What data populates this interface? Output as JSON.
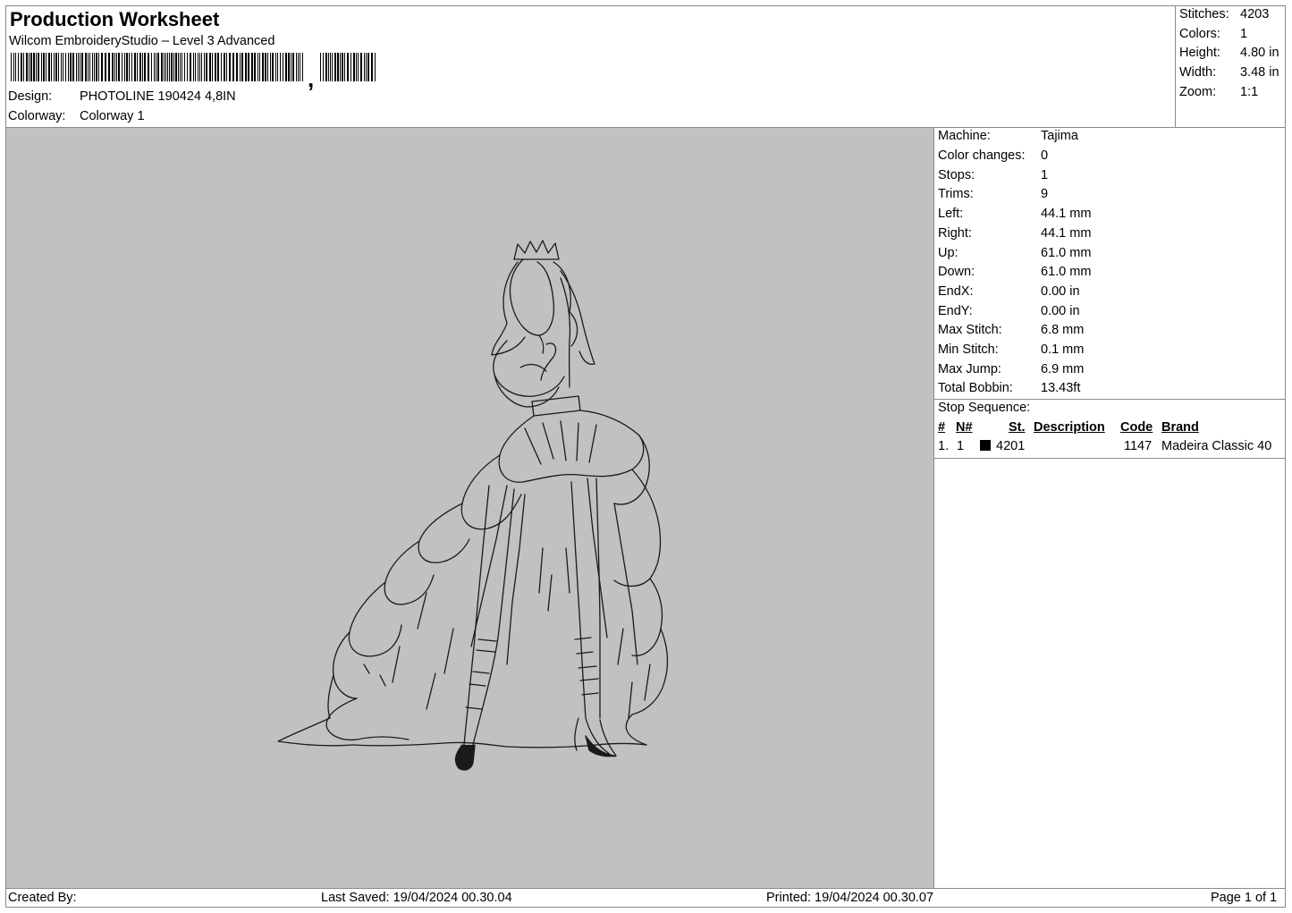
{
  "header": {
    "title": "Production Worksheet",
    "subtitle": "Wilcom EmbroideryStudio – Level 3 Advanced",
    "design_label": "Design:",
    "design_value": "PHOTOLINE 190424 4,8IN",
    "colorway_label": "Colorway:",
    "colorway_value": "Colorway 1"
  },
  "stats": [
    {
      "label": "Stitches:",
      "value": "4203"
    },
    {
      "label": "Colors:",
      "value": "1"
    },
    {
      "label": "Height:",
      "value": "4.80 in"
    },
    {
      "label": "Width:",
      "value": "3.48 in"
    },
    {
      "label": "Zoom:",
      "value": "1:1"
    }
  ],
  "machine_info": [
    {
      "label": "Machine:",
      "value": "Tajima"
    },
    {
      "label": "Color changes:",
      "value": "0"
    },
    {
      "label": "Stops:",
      "value": "1"
    },
    {
      "label": "Trims:",
      "value": "9"
    },
    {
      "label": "Left:",
      "value": "44.1 mm"
    },
    {
      "label": "Right:",
      "value": "44.1 mm"
    },
    {
      "label": "Up:",
      "value": "61.0 mm"
    },
    {
      "label": "Down:",
      "value": "61.0 mm"
    },
    {
      "label": "EndX:",
      "value": "0.00 in"
    },
    {
      "label": "EndY:",
      "value": "0.00 in"
    },
    {
      "label": "Max Stitch:",
      "value": "6.8 mm"
    },
    {
      "label": "Min Stitch:",
      "value": "0.1 mm"
    },
    {
      "label": "Max Jump:",
      "value": "6.9 mm"
    },
    {
      "label": "Total Bobbin:",
      "value": "13.43ft"
    }
  ],
  "stop_sequence": {
    "title": "Stop Sequence:",
    "columns": [
      "#",
      "N#",
      "St.",
      "Description",
      "Code",
      "Brand"
    ],
    "rows": [
      {
        "num": "1.",
        "n": "1",
        "color": "#000000",
        "st": "4201",
        "description": "",
        "code": "1147",
        "brand": "Madeira Classic 40"
      }
    ]
  },
  "footer": {
    "created_by": "Created By:",
    "last_saved": "Last Saved: 19/04/2024 00.30.04",
    "printed": "Printed: 19/04/2024 00.30.07",
    "page": "Page 1 of 1"
  },
  "colors": {
    "canvas_bg": "#c1c1c1",
    "stitch": "#1a1a1a"
  }
}
